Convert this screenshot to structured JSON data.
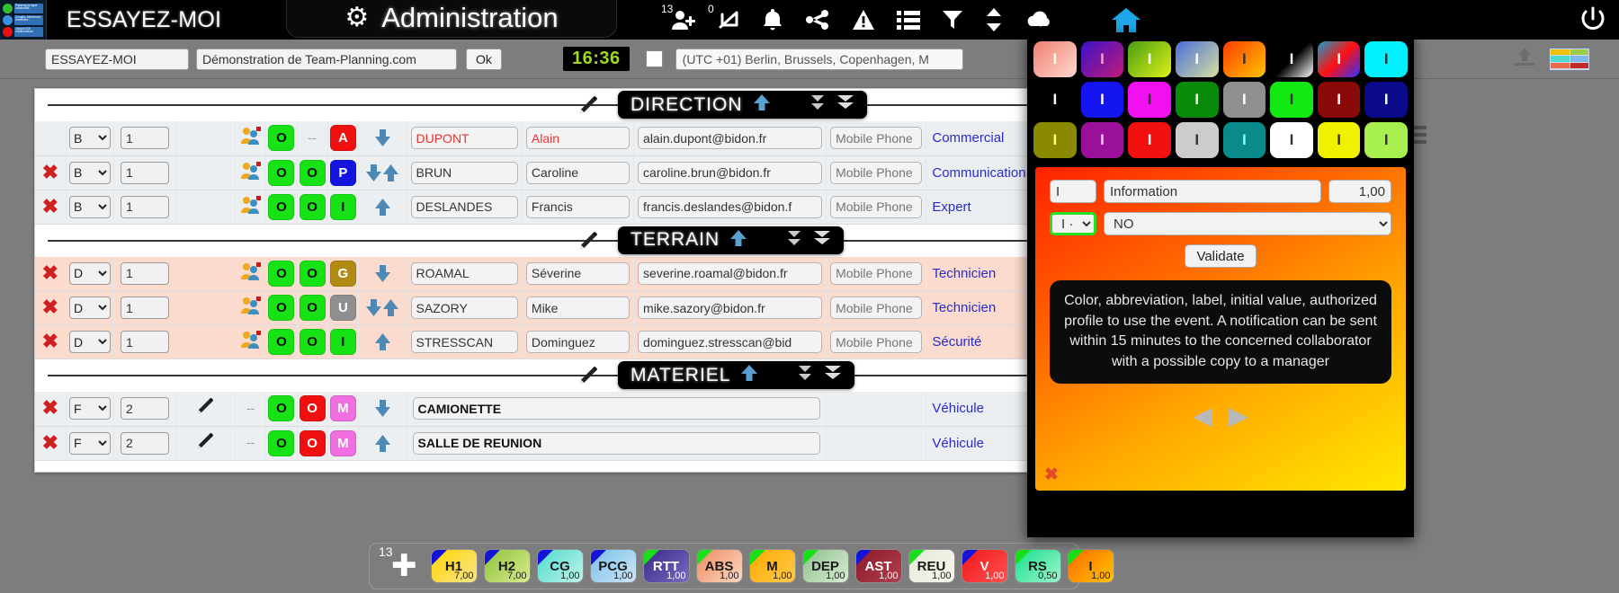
{
  "topbar": {
    "app_title": "ESSAYEZ-MOI",
    "admin_label": "Administration",
    "gear_icon": "gear-icon",
    "icons": [
      {
        "name": "add-user-icon",
        "badge": "13"
      },
      {
        "name": "swap-icon",
        "badge": "0"
      },
      {
        "name": "bell-icon",
        "badge": ""
      },
      {
        "name": "share-icon",
        "badge": ""
      },
      {
        "name": "alert-icon",
        "badge": ""
      },
      {
        "name": "list-icon",
        "badge": ""
      },
      {
        "name": "filter-icon",
        "badge": ""
      },
      {
        "name": "sort-icon",
        "badge": ""
      },
      {
        "name": "cloud-download-icon",
        "badge": ""
      }
    ],
    "home_icon": "home-icon",
    "home_color": "#1fa8e8",
    "power_icon": "power-icon",
    "logo_lines": [
      "Planning en ligne collaboratif",
      "Congés, Abscences, Astreintes ...",
      "Jusqu'à 100 collaborateurs"
    ]
  },
  "toolbar": {
    "code_value": "ESSAYEZ-MOI",
    "name_value": "Démonstration de Team-Planning.com",
    "ok_label": "Ok",
    "clock": "16:36",
    "dst_checkbox": false,
    "timezone": "(UTC +01) Berlin, Brussels, Copenhagen, M",
    "upload_icon": "upload-icon",
    "legend_icon": "legend-grid-icon",
    "menu_icon": "list-menu-icon"
  },
  "sections": [
    {
      "title": "DIRECTION",
      "up_icon": "arrow-up-icon",
      "collapse_icon": "collapse-icon",
      "chevrons_icon": "chevrons-down-icon",
      "tint": false,
      "rows": [
        {
          "delete": false,
          "profile": "B",
          "order": "1",
          "people_icon": "people-icon",
          "has_pencil": false,
          "chips": [
            {
              "t": "O",
              "bg": "#16e216",
              "fg": "#111"
            },
            {
              "t": "--",
              "bg": "transparent",
              "fg": "#999"
            },
            {
              "t": "A",
              "bg": "#f01010",
              "fg": "#fff"
            }
          ],
          "arrows": [
            "down"
          ],
          "last": "DUPONT",
          "first": "Alain",
          "red": true,
          "email": "alain.dupont@bidon.fr",
          "phone_ph": "Mobile Phone",
          "role": "Commercial",
          "upload_icon": "upload-icon",
          "lock": ""
        },
        {
          "delete": true,
          "profile": "B",
          "order": "1",
          "people_icon": "people-icon",
          "has_pencil": false,
          "chips": [
            {
              "t": "O",
              "bg": "#16e216",
              "fg": "#111"
            },
            {
              "t": "O",
              "bg": "#16e216",
              "fg": "#111"
            },
            {
              "t": "P",
              "bg": "#1414e0",
              "fg": "#fff"
            }
          ],
          "arrows": [
            "down",
            "up"
          ],
          "last": "BRUN",
          "first": "Caroline",
          "red": false,
          "email": "caroline.brun@bidon.fr",
          "phone_ph": "Mobile Phone",
          "role": "Communication",
          "upload_icon": "upload-icon",
          "lock": "green"
        },
        {
          "delete": true,
          "profile": "B",
          "order": "1",
          "people_icon": "people-icon",
          "has_pencil": false,
          "chips": [
            {
              "t": "O",
              "bg": "#16e216",
              "fg": "#111"
            },
            {
              "t": "O",
              "bg": "#16e216",
              "fg": "#111"
            },
            {
              "t": "I",
              "bg": "#16e216",
              "fg": "#111"
            }
          ],
          "arrows": [
            "up"
          ],
          "last": "DESLANDES",
          "first": "Francis",
          "red": false,
          "email": "francis.deslandes@bidon.f",
          "phone_ph": "Mobile Phone",
          "role": "Expert",
          "upload_icon": "upload-icon",
          "lock": "blue"
        }
      ]
    },
    {
      "title": "TERRAIN",
      "up_icon": "arrow-up-icon",
      "collapse_icon": "collapse-icon",
      "chevrons_icon": "chevrons-down-icon",
      "tint": true,
      "rows": [
        {
          "delete": true,
          "profile": "D",
          "order": "1",
          "people_icon": "people-icon",
          "has_pencil": false,
          "chips": [
            {
              "t": "O",
              "bg": "#16e216",
              "fg": "#111"
            },
            {
              "t": "O",
              "bg": "#16e216",
              "fg": "#111"
            },
            {
              "t": "G",
              "bg": "#b08a12",
              "fg": "#fff"
            }
          ],
          "arrows": [
            "down"
          ],
          "last": "ROAMAL",
          "first": "Séverine",
          "red": false,
          "email": "severine.roamal@bidon.fr",
          "phone_ph": "Mobile Phone",
          "role": "Technicien",
          "upload_icon": "upload-icon",
          "lock": "blue"
        },
        {
          "delete": true,
          "profile": "D",
          "order": "1",
          "people_icon": "people-icon",
          "has_pencil": false,
          "chips": [
            {
              "t": "O",
              "bg": "#16e216",
              "fg": "#111"
            },
            {
              "t": "O",
              "bg": "#16e216",
              "fg": "#111"
            },
            {
              "t": "U",
              "bg": "#8f8f8f",
              "fg": "#fff"
            }
          ],
          "arrows": [
            "down",
            "up"
          ],
          "last": "SAZORY",
          "first": "Mike",
          "red": false,
          "email": "mike.sazory@bidon.fr",
          "phone_ph": "Mobile Phone",
          "role": "Technicien",
          "upload_icon": "upload-icon",
          "lock": "blue"
        },
        {
          "delete": true,
          "profile": "D",
          "order": "1",
          "people_icon": "people-icon",
          "has_pencil": false,
          "chips": [
            {
              "t": "O",
              "bg": "#16e216",
              "fg": "#111"
            },
            {
              "t": "O",
              "bg": "#16e216",
              "fg": "#111"
            },
            {
              "t": "I",
              "bg": "#16e216",
              "fg": "#111"
            }
          ],
          "arrows": [
            "up"
          ],
          "last": "STRESSCAN",
          "first": "Dominguez",
          "red": false,
          "email": "dominguez.stresscan@bid",
          "phone_ph": "Mobile Phone",
          "role": "Sécurité",
          "upload_icon": "upload-icon",
          "lock": "blue"
        }
      ]
    },
    {
      "title": "MATERIEL",
      "up_icon": "arrow-up-icon",
      "collapse_icon": "collapse-icon",
      "chevrons_icon": "chevrons-down-icon",
      "tint": false,
      "rows": [
        {
          "delete": true,
          "profile": "F",
          "order": "2",
          "people_icon": "pencil-icon",
          "has_pencil": true,
          "chips": [
            {
              "t": "O",
              "bg": "#16e216",
              "fg": "#111"
            },
            {
              "t": "O",
              "bg": "#f01010",
              "fg": "#fff"
            },
            {
              "t": "M",
              "bg": "#ef6fe0",
              "fg": "#fff"
            }
          ],
          "arrows": [
            "down"
          ],
          "last": "CAMIONETTE",
          "first": "",
          "red": false,
          "email": "",
          "phone_ph": "",
          "role": "Véhicule",
          "upload_icon": "upload-icon",
          "lock": ""
        },
        {
          "delete": true,
          "profile": "F",
          "order": "2",
          "people_icon": "pencil-icon",
          "has_pencil": true,
          "chips": [
            {
              "t": "O",
              "bg": "#16e216",
              "fg": "#111"
            },
            {
              "t": "O",
              "bg": "#f01010",
              "fg": "#fff"
            },
            {
              "t": "M",
              "bg": "#ef6fe0",
              "fg": "#fff"
            }
          ],
          "arrows": [
            "up"
          ],
          "last": "SALLE DE REUNION",
          "first": "",
          "red": false,
          "email": "",
          "phone_ph": "",
          "role": "Véhicule",
          "upload_icon": "upload-icon",
          "lock": ""
        }
      ]
    }
  ],
  "popup": {
    "swatches": [
      {
        "label": "I",
        "fg": "#ffffff",
        "bg": "linear-gradient(135deg,#f08070,#ffd8d0)"
      },
      {
        "label": "I",
        "fg": "#ff9ad0",
        "bg": "linear-gradient(135deg,#3a12c8,#c21a7a)"
      },
      {
        "label": "I",
        "fg": "#ffffff",
        "bg": "linear-gradient(135deg,#4a9e12,#ddf018)"
      },
      {
        "label": "I",
        "fg": "#ffffff",
        "bg": "linear-gradient(135deg,#4a6ed8,#d8e0a0)"
      },
      {
        "label": "I",
        "fg": "#333333",
        "bg": "linear-gradient(135deg,#ff3c00,#ffc400)"
      },
      {
        "label": "I",
        "fg": "#ffffff",
        "bg": "linear-gradient(135deg,#000000 50%,#ffffff 100%)"
      },
      {
        "label": "I",
        "fg": "#ffffff",
        "bg": "linear-gradient(135deg,#10a0c8,#ff1010,#3030ff)"
      },
      {
        "label": "I",
        "fg": "#333333",
        "bg": "#00f0ff"
      },
      {
        "label": "I",
        "fg": "#ffffff",
        "bg": "#000000"
      },
      {
        "label": "I",
        "fg": "#ffffff",
        "bg": "#1414f0"
      },
      {
        "label": "I",
        "fg": "#333333",
        "bg": "#f010f0"
      },
      {
        "label": "I",
        "fg": "#ffffff",
        "bg": "#0a8a0a"
      },
      {
        "label": "I",
        "fg": "#ffffff",
        "bg": "#8f8f8f"
      },
      {
        "label": "I",
        "fg": "#333333",
        "bg": "#12e812"
      },
      {
        "label": "I",
        "fg": "#ffffff",
        "bg": "#8a0a0a"
      },
      {
        "label": "I",
        "fg": "#ffffff",
        "bg": "#0a0a8a"
      },
      {
        "label": "I",
        "fg": "#ffff80",
        "bg": "#8a8a00"
      },
      {
        "label": "I",
        "fg": "#ffc0ff",
        "bg": "#9a109a"
      },
      {
        "label": "I",
        "fg": "#ffffff",
        "bg": "#f01010"
      },
      {
        "label": "I",
        "fg": "#333333",
        "bg": "#cccccc"
      },
      {
        "label": "I",
        "fg": "#80ffff",
        "bg": "#0a8a8a"
      },
      {
        "label": "I",
        "fg": "#333333",
        "bg": "#ffffff"
      },
      {
        "label": "I",
        "fg": "#333333",
        "bg": "#f0f000"
      },
      {
        "label": "I",
        "fg": "#333333",
        "bg": "#a8f050"
      }
    ],
    "abbr_value": "I",
    "label_value": "Information",
    "initial_value": "1,00",
    "profile_value": "I · ",
    "notify_value": "NO",
    "validate_label": "Validate",
    "tip_text": "Color, abbreviation, label, initial value, authorized profile to use the event. A notification can be sent within 15 minutes to the concerned collaborator with a possible copy to a manager",
    "prev_icon": "prev-triangle-icon",
    "next_icon": "next-triangle-icon",
    "close_icon": "close-x-icon"
  },
  "legend": {
    "count": "13",
    "add_icon": "plus-icon",
    "events": [
      {
        "code": "H1",
        "value": "7,00",
        "bg": "linear-gradient(135deg,#ffd400,#f7e58a)",
        "fg": "#1a1a1a",
        "corner": "#1414d8"
      },
      {
        "code": "H2",
        "value": "7,00",
        "bg": "linear-gradient(135deg,#8fc43a,#d8ea90)",
        "fg": "#1a1a1a",
        "corner": "#1414d8"
      },
      {
        "code": "CG",
        "value": "1,00",
        "bg": "linear-gradient(135deg,#4fdccb,#bff3ea)",
        "fg": "#1a1a1a",
        "corner": "#1414d8"
      },
      {
        "code": "PCG",
        "value": "1,00",
        "bg": "linear-gradient(135deg,#79c0ea,#cde6f7)",
        "fg": "#1a1a1a",
        "corner": "#1414d8"
      },
      {
        "code": "RTT",
        "value": "1,00",
        "bg": "linear-gradient(135deg,#3a2a8a,#7a6ac0)",
        "fg": "#ffffff",
        "corner": "#18e018"
      },
      {
        "code": "ABS",
        "value": "1,00",
        "bg": "linear-gradient(135deg,#f08a60,#fbd9c4)",
        "fg": "#1a1a1a",
        "corner": "#18e018"
      },
      {
        "code": "M",
        "value": "1,00",
        "bg": "linear-gradient(135deg,#ffa800,#ffcb4a)",
        "fg": "#1a1a1a",
        "corner": "#18e018"
      },
      {
        "code": "DEP",
        "value": "1,00",
        "bg": "linear-gradient(135deg,#8fc08a,#d8ecd4)",
        "fg": "#1a1a1a",
        "corner": "#18e018"
      },
      {
        "code": "AST",
        "value": "1,00",
        "bg": "linear-gradient(135deg,#8a1828,#b04050)",
        "fg": "#ffffff",
        "corner": "#1414d8"
      },
      {
        "code": "REU",
        "value": "1,00",
        "bg": "linear-gradient(135deg,#e8e8d8,#f6f6ee)",
        "fg": "#1a1a1a",
        "corner": "#18e018"
      },
      {
        "code": "V",
        "value": "1,00",
        "bg": "linear-gradient(135deg,#f01818,#ff5050)",
        "fg": "#ffffff",
        "corner": "#1414d8"
      },
      {
        "code": "RS",
        "value": "0,50",
        "bg": "linear-gradient(135deg,#18e090,#9df5cb)",
        "fg": "#1a1a1a",
        "corner": "#18e018"
      },
      {
        "code": "I",
        "value": "1,00",
        "bg": "linear-gradient(135deg,#ff6a00,#ffc400)",
        "fg": "#1a1a1a",
        "corner": "#18e018"
      }
    ]
  }
}
